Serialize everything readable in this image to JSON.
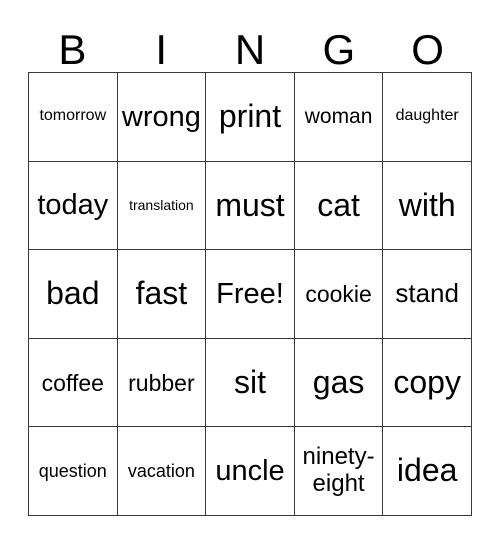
{
  "card": {
    "headers": [
      "B",
      "I",
      "N",
      "G",
      "O"
    ],
    "rows": [
      [
        {
          "text": "tomorrow",
          "size": "fs-s"
        },
        {
          "text": "wrong",
          "size": "fs-xl"
        },
        {
          "text": "print",
          "size": "fs-xxl"
        },
        {
          "text": "woman",
          "size": "fs-m"
        },
        {
          "text": "daughter",
          "size": "fs-s"
        }
      ],
      [
        {
          "text": "today",
          "size": "fs-xl"
        },
        {
          "text": "translation",
          "size": "fs-xs"
        },
        {
          "text": "must",
          "size": "fs-xxl"
        },
        {
          "text": "cat",
          "size": "fs-xxl"
        },
        {
          "text": "with",
          "size": "fs-xxl"
        }
      ],
      [
        {
          "text": "bad",
          "size": "fs-xxl"
        },
        {
          "text": "fast",
          "size": "fs-xxl"
        },
        {
          "text": "Free!",
          "size": "fs-xl"
        },
        {
          "text": "cookie",
          "size": "fs-ml"
        },
        {
          "text": "stand",
          "size": "fs-l"
        }
      ],
      [
        {
          "text": "coffee",
          "size": "fs-ml"
        },
        {
          "text": "rubber",
          "size": "fs-ml"
        },
        {
          "text": "sit",
          "size": "fs-xxl"
        },
        {
          "text": "gas",
          "size": "fs-xxl"
        },
        {
          "text": "copy",
          "size": "fs-xxl"
        }
      ],
      [
        {
          "text": "question",
          "size": "fs-sm"
        },
        {
          "text": "vacation",
          "size": "fs-sm"
        },
        {
          "text": "uncle",
          "size": "fs-xl"
        },
        {
          "text": "ninety-\neight",
          "size": "fs-wrap"
        },
        {
          "text": "idea",
          "size": "fs-xxl"
        }
      ]
    ],
    "free_space_label": "Free!",
    "colors": {
      "text": "#000000",
      "border": "#3a3a3a",
      "background": "#ffffff"
    }
  }
}
